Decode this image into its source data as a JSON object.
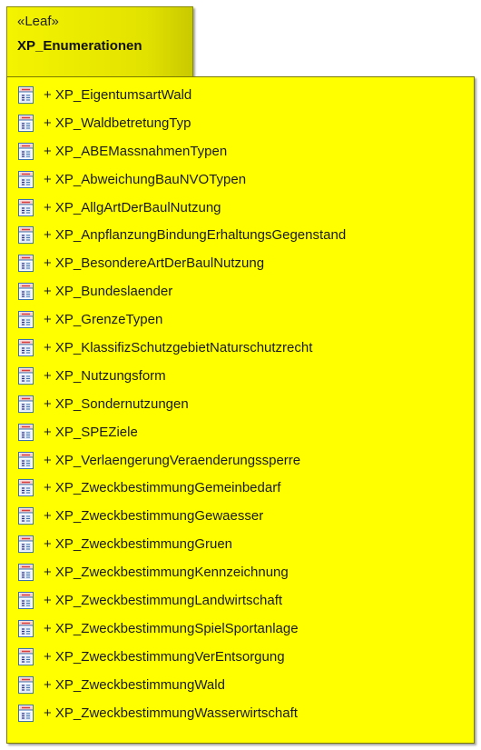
{
  "package": {
    "stereotype": "«Leaf»",
    "name": "XP_Enumerationen"
  },
  "items": [
    {
      "label": "+ XP_EigentumsartWald",
      "icon": "enumeration-icon"
    },
    {
      "label": "+ XP_WaldbetretungTyp",
      "icon": "enumeration-icon"
    },
    {
      "label": "+ XP_ABEMassnahmenTypen",
      "icon": "enumeration-icon"
    },
    {
      "label": "+ XP_AbweichungBauNVOTypen",
      "icon": "enumeration-icon"
    },
    {
      "label": "+ XP_AllgArtDerBaulNutzung",
      "icon": "enumeration-icon"
    },
    {
      "label": "+ XP_AnpflanzungBindungErhaltungsGegenstand",
      "icon": "enumeration-icon"
    },
    {
      "label": "+ XP_BesondereArtDerBaulNutzung",
      "icon": "enumeration-icon"
    },
    {
      "label": "+ XP_Bundeslaender",
      "icon": "enumeration-icon"
    },
    {
      "label": "+ XP_GrenzeTypen",
      "icon": "enumeration-icon"
    },
    {
      "label": "+ XP_KlassifizSchutzgebietNaturschutzrecht",
      "icon": "enumeration-icon"
    },
    {
      "label": "+ XP_Nutzungsform",
      "icon": "enumeration-icon"
    },
    {
      "label": "+ XP_Sondernutzungen",
      "icon": "enumeration-icon"
    },
    {
      "label": "+ XP_SPEZiele",
      "icon": "enumeration-icon"
    },
    {
      "label": "+ XP_VerlaengerungVeraenderungssperre",
      "icon": "enumeration-icon"
    },
    {
      "label": "+ XP_ZweckbestimmungGemeinbedarf",
      "icon": "enumeration-icon"
    },
    {
      "label": "+ XP_ZweckbestimmungGewaesser",
      "icon": "enumeration-icon"
    },
    {
      "label": "+ XP_ZweckbestimmungGruen",
      "icon": "enumeration-icon"
    },
    {
      "label": "+ XP_ZweckbestimmungKennzeichnung",
      "icon": "enumeration-icon"
    },
    {
      "label": "+ XP_ZweckbestimmungLandwirtschaft",
      "icon": "enumeration-icon"
    },
    {
      "label": "+ XP_ZweckbestimmungSpielSportanlage",
      "icon": "enumeration-icon"
    },
    {
      "label": "+ XP_ZweckbestimmungVerEntsorgung",
      "icon": "enumeration-icon"
    },
    {
      "label": "+ XP_ZweckbestimmungWald",
      "icon": "enumeration-icon"
    },
    {
      "label": "+ XP_ZweckbestimmungWasserwirtschaft",
      "icon": "enumeration-icon"
    }
  ],
  "colors": {
    "package_fill": "#ffff00",
    "icon_frame": "#3a6fb0",
    "icon_header": "#e23a3a"
  }
}
